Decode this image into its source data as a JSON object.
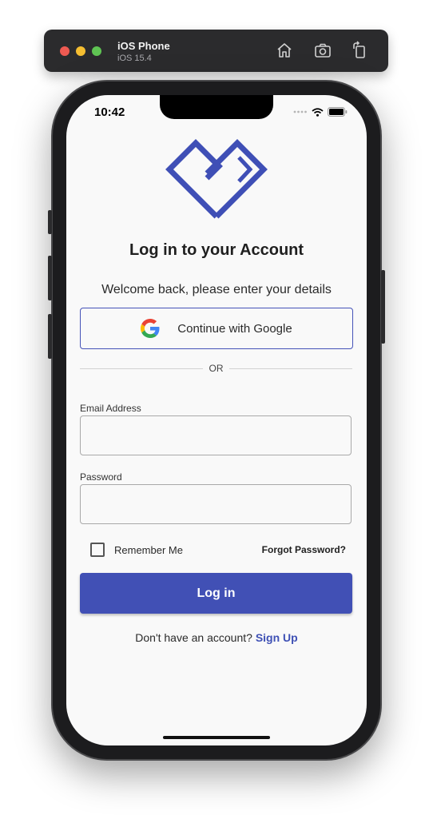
{
  "simulator": {
    "device_name": "iOS Phone",
    "os_version": "iOS 15.4",
    "icons": [
      "home-icon",
      "screenshot-icon",
      "rotate-icon"
    ]
  },
  "status_bar": {
    "time": "10:42",
    "icons": [
      "cellular-icon",
      "wifi-icon",
      "battery-icon"
    ]
  },
  "login": {
    "logo_icon": "heart-logo-icon",
    "title": "Log in to your Account",
    "subtitle": "Welcome back, please enter your details",
    "google_button_label": "Continue with Google",
    "divider_text": "OR",
    "email_label": "Email Address",
    "email_value": "",
    "password_label": "Password",
    "password_value": "",
    "remember_label": "Remember Me",
    "remember_checked": false,
    "forgot_label": "Forgot Password?",
    "login_button_label": "Log in",
    "signup_prompt": "Don't have an account?",
    "signup_link": "Sign Up"
  },
  "colors": {
    "accent": "#4150b5",
    "link": "#3f51b5",
    "screen_background": "#f9f9f9"
  }
}
